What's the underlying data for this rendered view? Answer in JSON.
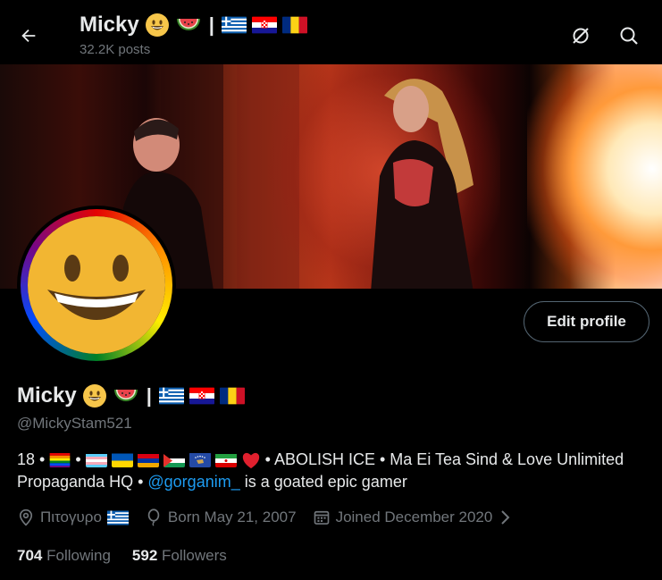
{
  "header": {
    "display_name": "Micky",
    "separator": "|",
    "post_count": "32.2K posts"
  },
  "profile": {
    "display_name": "Micky",
    "separator": "|",
    "handle": "@MickyStam521",
    "edit_button": "Edit profile",
    "bio": {
      "age": "18",
      "bullet": "•",
      "line1_text": "• ABOLISH ICE • Ma Ei Tea Sind & Love Unlimited",
      "line2_text_a": "Propaganda HQ •",
      "mention": "@gorganim_",
      "line2_text_b": "is a goated epic gamer"
    },
    "location": "Πιτογυρο",
    "birthday": "Born May 21, 2007",
    "joined": "Joined December 2020",
    "following_count": "704",
    "following_label": "Following",
    "followers_count": "592",
    "followers_label": "Followers"
  },
  "icons": {
    "back": "arrow-left-icon",
    "lock": "spam-filter-icon",
    "search": "search-icon",
    "location": "location-pin-icon",
    "birthday": "balloon-icon",
    "calendar": "calendar-icon",
    "chevron": "chevron-right-icon"
  },
  "colors": {
    "background": "#000000",
    "text": "#e7e9ea",
    "muted": "#71767b",
    "link": "#1d9bf0",
    "border": "#536471"
  }
}
